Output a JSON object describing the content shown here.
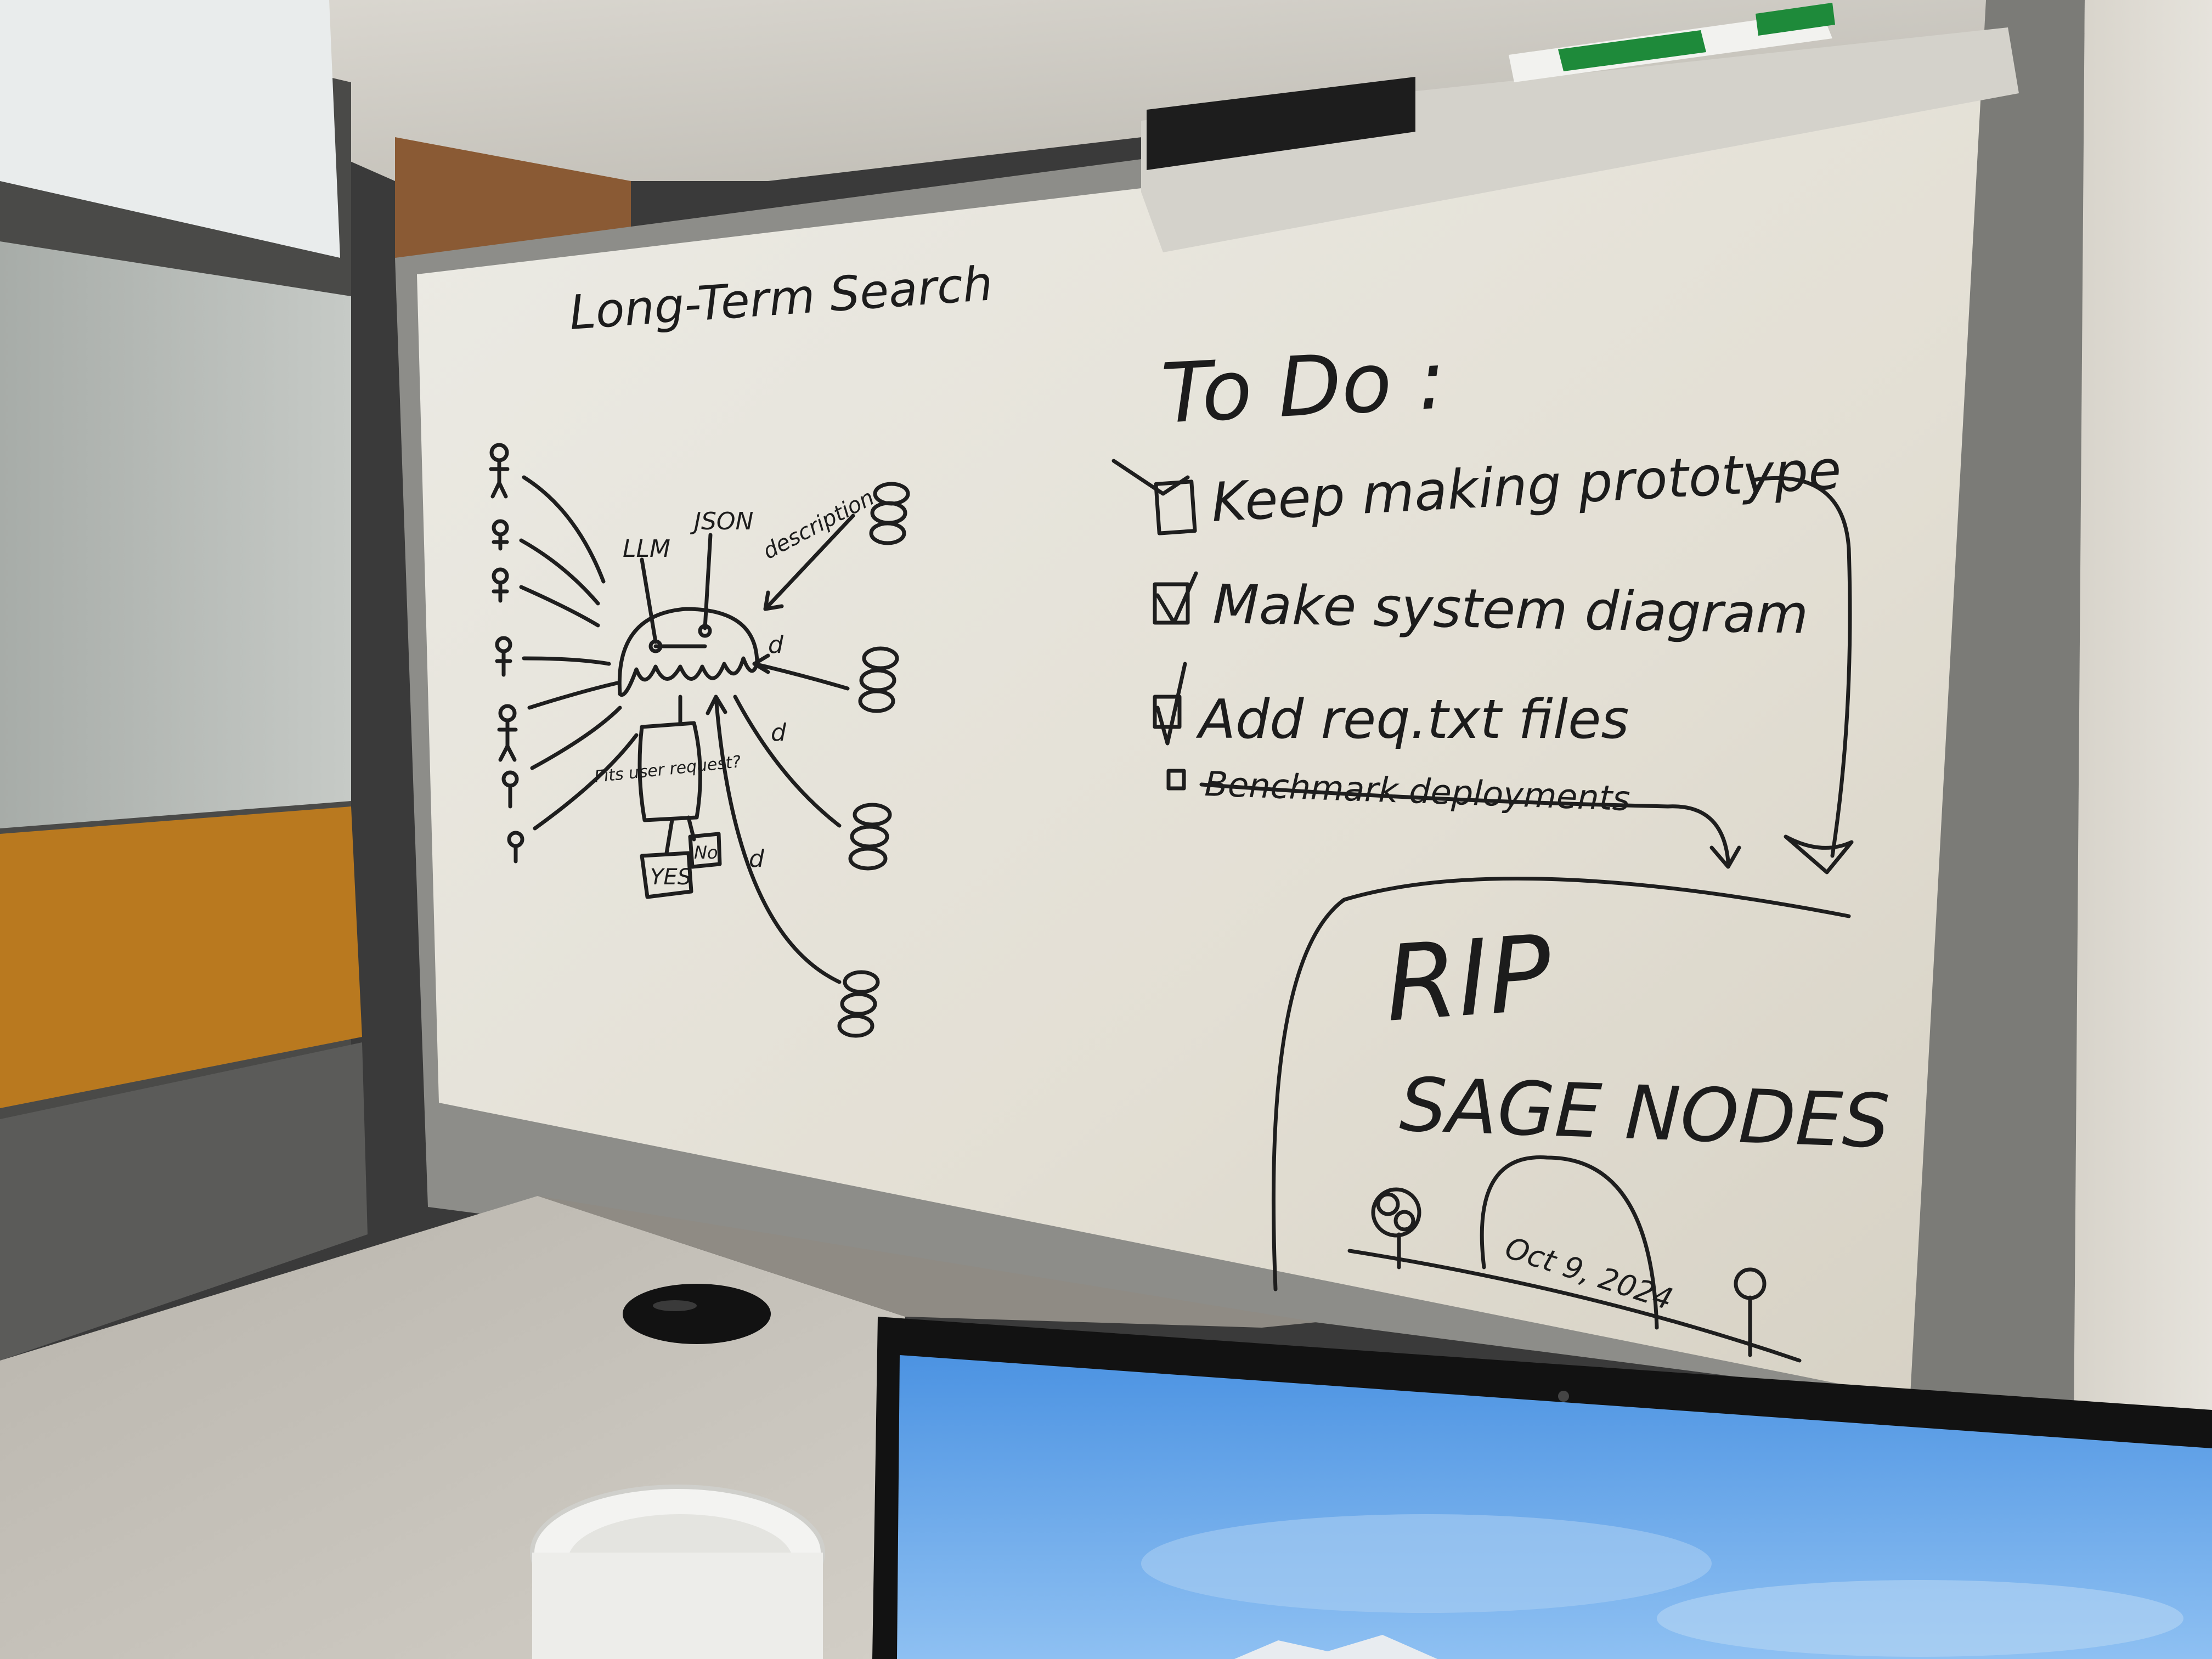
{
  "colors": {
    "ceiling": "#cfccc4",
    "whiteboard": "#e6e2d8",
    "board_frame": "#8c8c88",
    "ink": "#1e1e1e",
    "orange_panel": "#b9791f",
    "frosted_glass": "#b8bdb9",
    "desk": "#c9c5bd",
    "monitor_bezel": "#121212",
    "sky": "#5a9ee8",
    "marker_green": "#1e8a3a"
  },
  "whiteboard": {
    "left_diagram": {
      "title": "Long-Term Search",
      "hub_labels": {
        "llm": "LLM",
        "json": "JSON",
        "description": "description"
      },
      "decision_box": "Fits user request?",
      "yes_box": "YES",
      "no_box": "No",
      "small_marks": [
        "d",
        "d",
        "d"
      ]
    },
    "todo": {
      "heading": "To Do :",
      "items": [
        {
          "label": "Keep making prototype",
          "checked": true,
          "struck": false
        },
        {
          "label": "Make system diagram",
          "checked": true,
          "struck": false
        },
        {
          "label": "Add req.txt files",
          "checked": true,
          "struck": false
        },
        {
          "label": "Benchmark deployments",
          "checked": false,
          "struck": true
        }
      ]
    },
    "memorial": {
      "title": "RIP",
      "subtitle": "SAGE NODES",
      "tombstone_date": "Oct 9, 2024"
    }
  },
  "icons": {
    "stick_figures": "stick-figure-icon",
    "nodes": "stacked-circles-icon",
    "tree": "tree-icon",
    "tombstone": "tombstone-icon",
    "coffee_cup": "coffee-cup-lid-icon",
    "grommet": "desk-grommet-icon",
    "marker": "whiteboard-marker-icon"
  }
}
